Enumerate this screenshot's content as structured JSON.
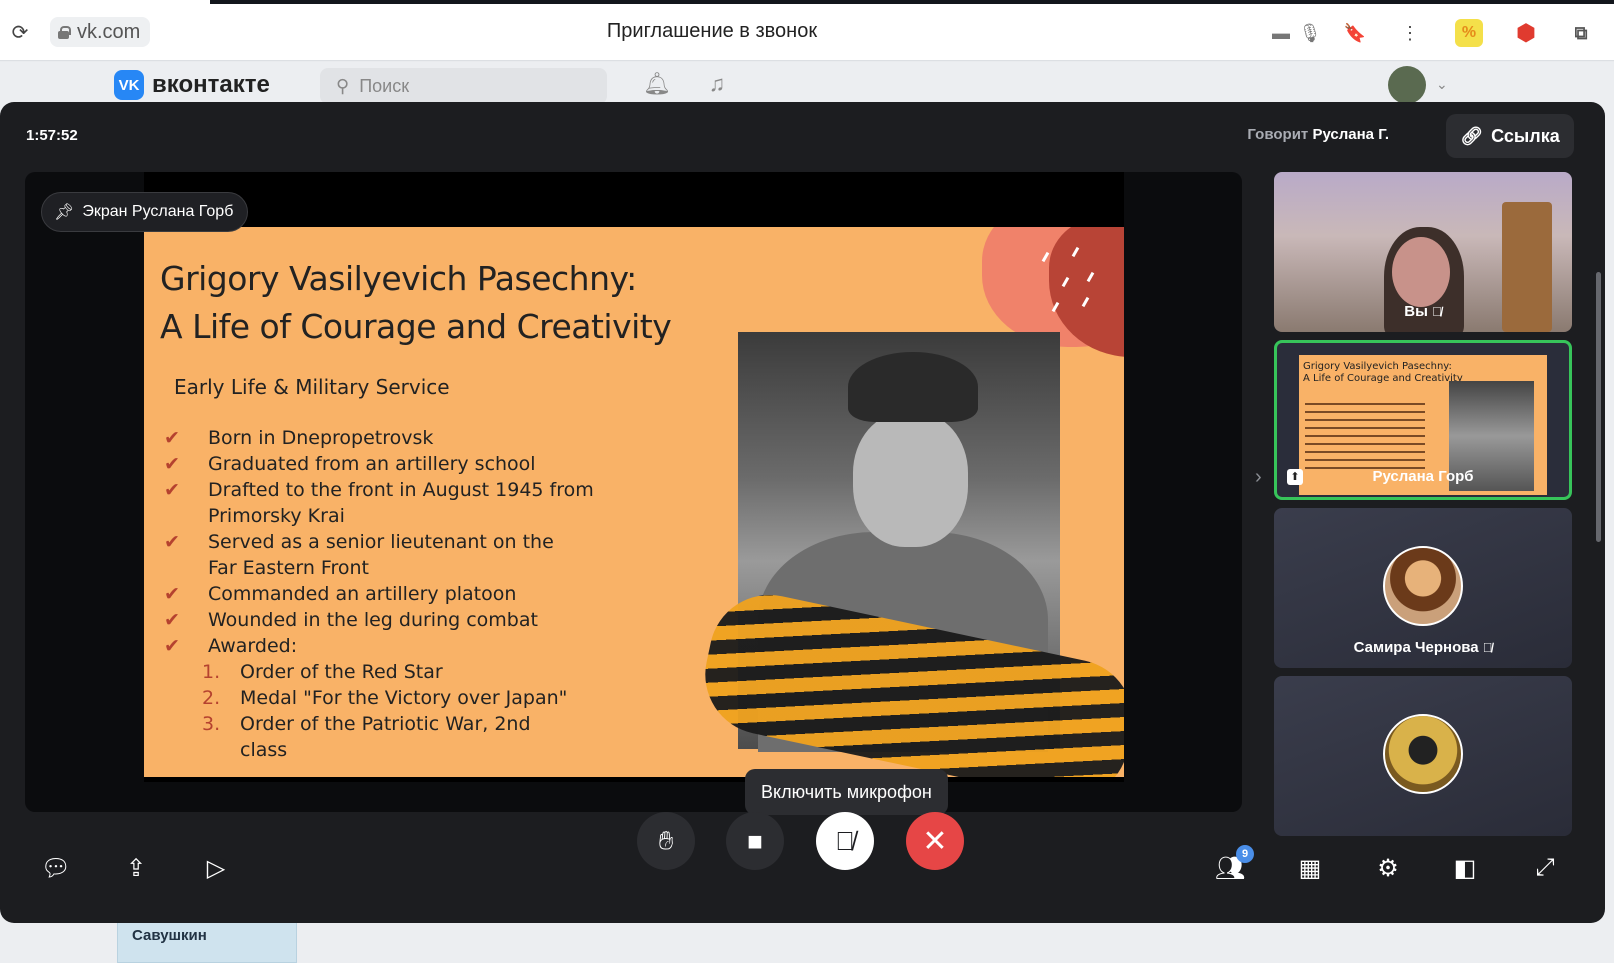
{
  "browser": {
    "url": "vk.com",
    "page_title": "Приглашение в звонок"
  },
  "vk": {
    "logo_text": "вконтакте",
    "logo_mark": "VK",
    "search_placeholder": "Поиск",
    "below_card_text": "Савушкин"
  },
  "call": {
    "timer": "1:57:52",
    "speaking_label": "Говорит",
    "speaking_name": "Руслана Г.",
    "link_label": "Ссылка",
    "pinned_screen_label": "Экран Руслана Горб",
    "tooltip": "Включить микрофон",
    "participants_count": "9",
    "end_call_color": "#e64646",
    "active_tile_color": "#37c45a"
  },
  "slide": {
    "title_line1": "Grigory Vasilyevich Pasechny:",
    "title_line2": "A Life of Courage and Creativity",
    "subtitle": "Early Life & Military Service",
    "checks": [
      "Born in Dnepropetrovsk",
      "Graduated from an artillery school",
      "Drafted to the front in August 1945 from",
      "Primorsky Krai",
      "Served as a senior lieutenant on the",
      "Far Eastern Front",
      "Commanded an artillery platoon",
      "Wounded in the leg during combat",
      "Awarded:"
    ],
    "awards": [
      {
        "n": "1.",
        "text": "Order of the Red Star"
      },
      {
        "n": "2.",
        "text": "Medal \"For the Victory over Japan\""
      },
      {
        "n": "3.",
        "text": "Order of the Patriotic War, 2nd"
      },
      {
        "n": "",
        "text": "class"
      }
    ],
    "mini_title": "Grigory Vasilyevich Pasechny:\nA Life of Courage and Creativity"
  },
  "participants": [
    {
      "name": "Вы",
      "muted": true
    },
    {
      "name": "Руслана Горб",
      "muted": false
    },
    {
      "name": "Самира Чернова",
      "muted": true
    },
    {
      "name": "",
      "muted": false
    }
  ]
}
